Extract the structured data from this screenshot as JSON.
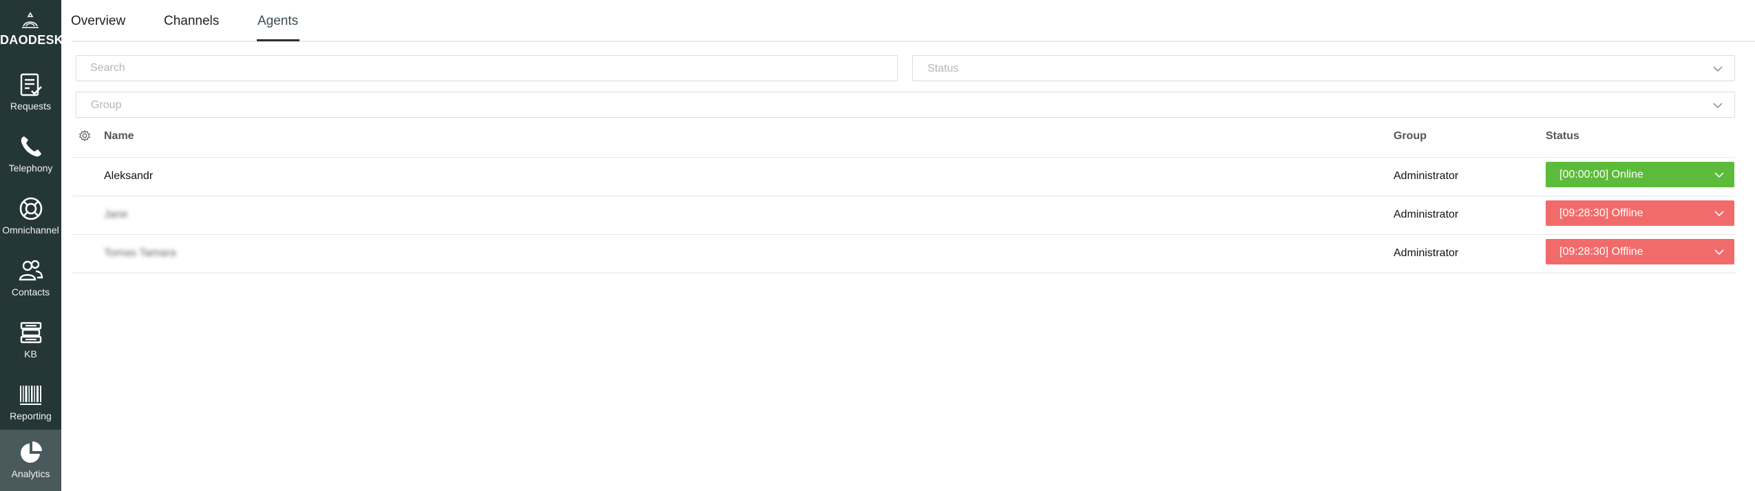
{
  "app": {
    "logo_text": "DAODESK"
  },
  "sidebar": {
    "items": [
      {
        "label": "Requests",
        "icon": "requests-icon"
      },
      {
        "label": "Telephony",
        "icon": "phone-icon"
      },
      {
        "label": "Omnichannel",
        "icon": "lifebuoy-icon"
      },
      {
        "label": "Contacts",
        "icon": "contacts-icon"
      },
      {
        "label": "KB",
        "icon": "knowledge-base-icon"
      },
      {
        "label": "Reporting",
        "icon": "barcode-icon"
      },
      {
        "label": "Analytics",
        "icon": "pie-chart-icon"
      }
    ],
    "active": "Analytics"
  },
  "tabs": [
    {
      "label": "Overview"
    },
    {
      "label": "Channels"
    },
    {
      "label": "Agents"
    }
  ],
  "active_tab": "Agents",
  "filters": {
    "search_placeholder": "Search",
    "status_placeholder": "Status",
    "group_placeholder": "Group"
  },
  "table": {
    "headers": {
      "name": "Name",
      "group": "Group",
      "status": "Status"
    },
    "rows": [
      {
        "name": "Aleksandr",
        "group": "Administrator",
        "status": "[00:00:00] Online",
        "status_color": "#5cbb3a",
        "name_obscured": false
      },
      {
        "name": "Jane",
        "group": "Administrator",
        "status": "[09:28:30] Offline",
        "status_color": "#f26b6b",
        "name_obscured": true
      },
      {
        "name": "Tomas Tamara",
        "group": "Administrator",
        "status": "[09:28:30] Offline",
        "status_color": "#f26b6b",
        "name_obscured": true
      }
    ]
  },
  "colors": {
    "sidebar_bg": "#253636",
    "sidebar_active": "#4a5a5c",
    "online": "#5cbb3a",
    "offline": "#f26b6b"
  }
}
